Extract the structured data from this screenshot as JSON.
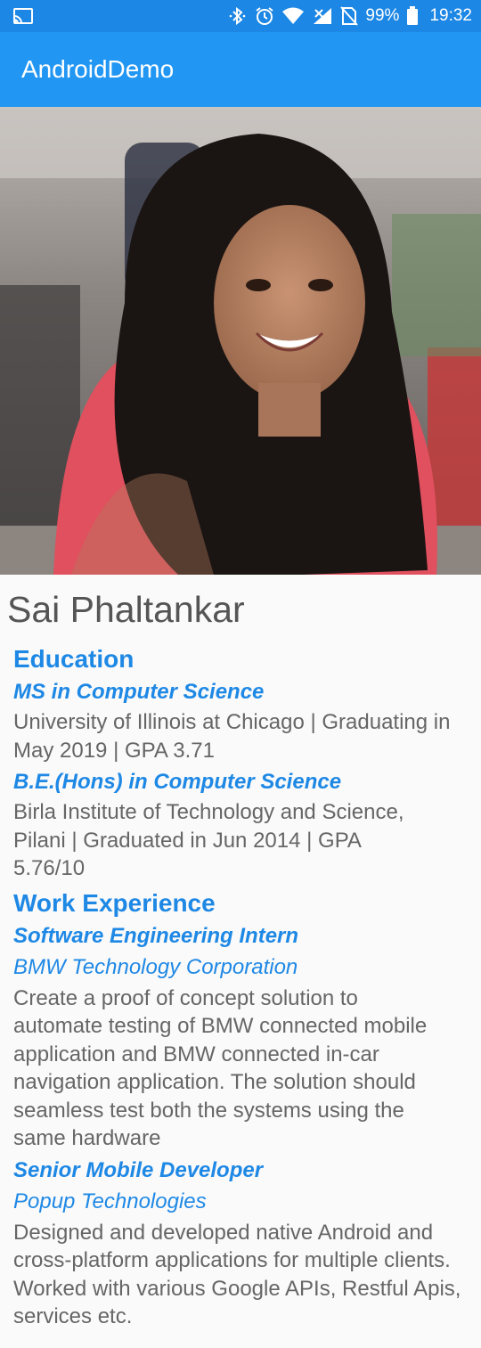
{
  "status_bar": {
    "battery": "99%",
    "time": "19:32"
  },
  "app_bar": {
    "title": "AndroidDemo"
  },
  "profile": {
    "name": "Sai Phaltankar"
  },
  "education": {
    "title": "Education",
    "entries": [
      {
        "degree": "MS in Computer Science",
        "details": "University of Illinois at Chicago | Graduating in May 2019 | GPA 3.71"
      },
      {
        "degree": "B.E.(Hons) in Computer Science",
        "details": "Birla Institute of Technology and Science, Pilani | Graduated in Jun 2014 | GPA 5.76/10"
      }
    ]
  },
  "work": {
    "title": "Work Experience",
    "entries": [
      {
        "role": "Software Engineering Intern",
        "company": "BMW Technology Corporation",
        "description": "Create a proof of concept solution to automate testing of BMW connected mobile application and BMW connected in-car navigation application. The solution should seamless test both the systems using the same hardware"
      },
      {
        "role": "Senior Mobile Developer",
        "company": "Popup Technologies",
        "description": "Designed and developed native Android and cross-platform applications for multiple clients. Worked with various Google APIs, Restful Apis, services etc."
      }
    ]
  },
  "colors": {
    "status_bar": "#1c87e4",
    "app_bar": "#2196f3",
    "accent_text": "#1e88e5",
    "body_text": "#666666",
    "name_text": "#555555",
    "background": "#fafafa"
  },
  "icons": [
    "cast-icon",
    "bluetooth-icon",
    "alarm-icon",
    "wifi-icon",
    "signal-icon",
    "no-sim-icon",
    "battery-icon"
  ]
}
